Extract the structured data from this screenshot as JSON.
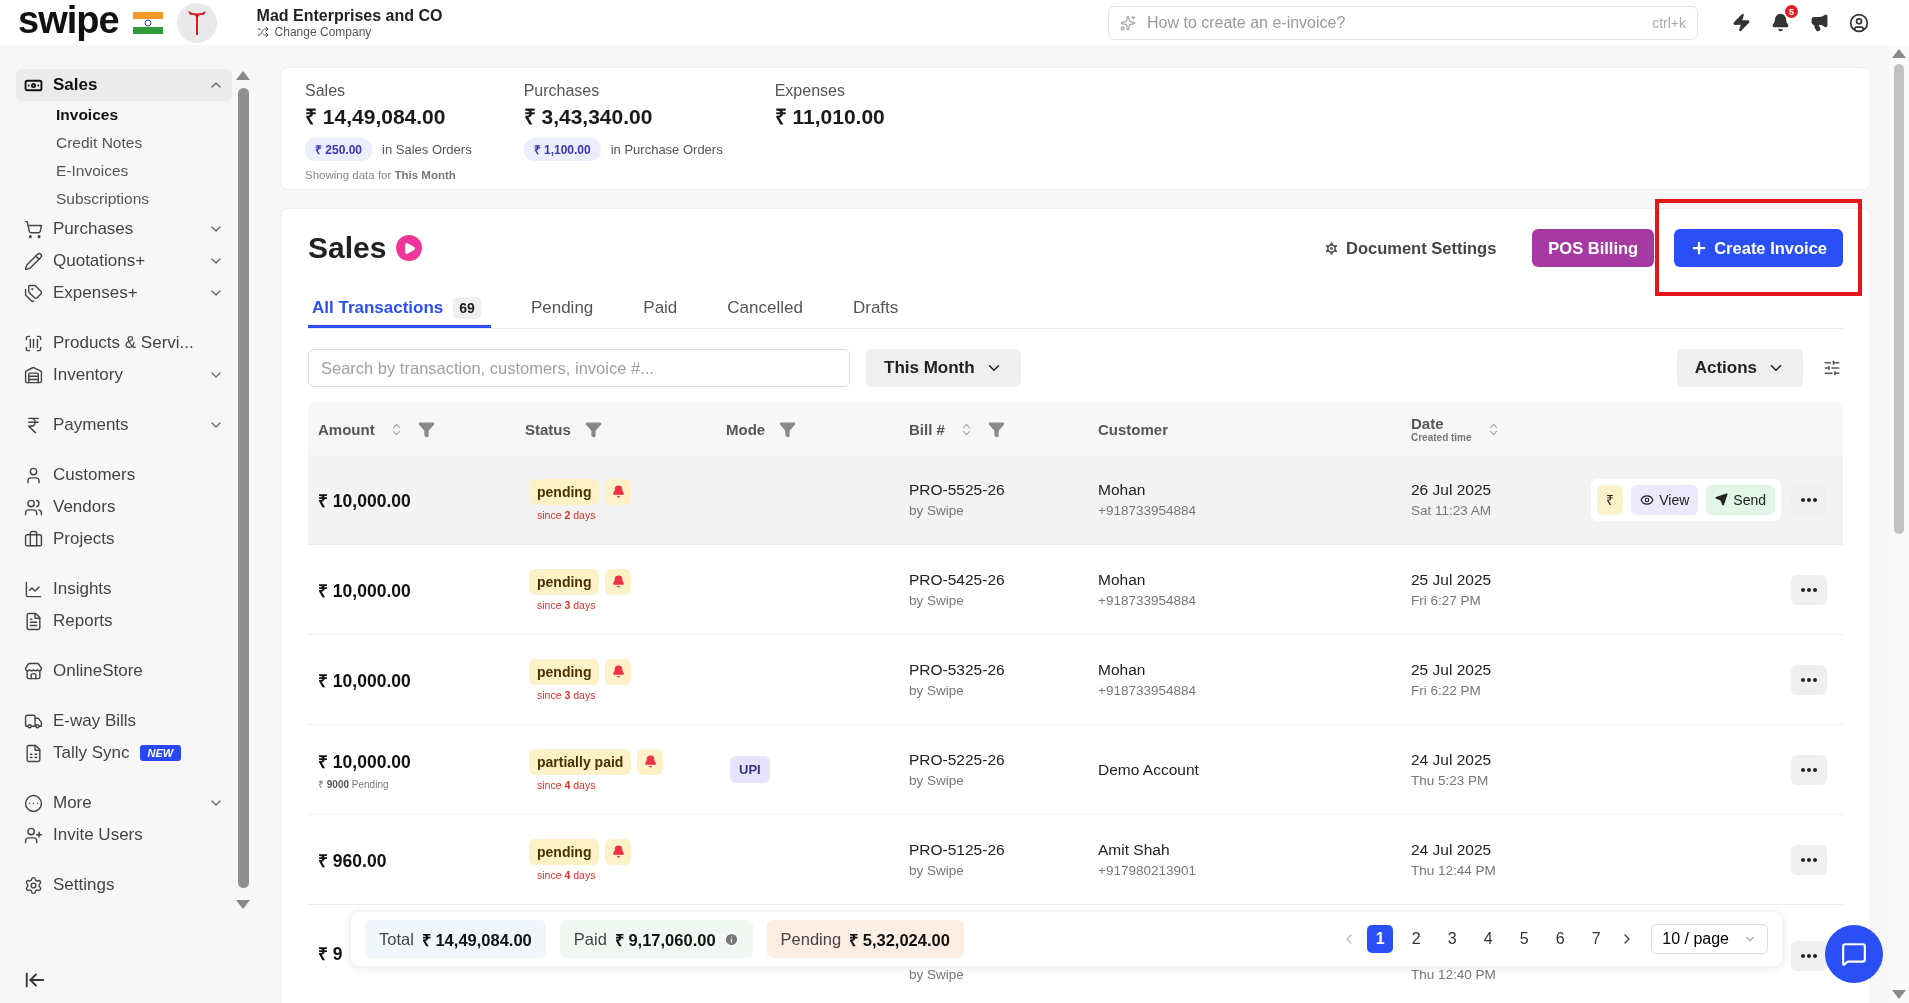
{
  "header": {
    "logo": "swipe",
    "company": "Mad Enterprises and CO",
    "change_company": "Change Company",
    "search": {
      "placeholder": "How to create an e-invoice?",
      "shortcut": "ctrl+k"
    },
    "notification_count": "5"
  },
  "sidebar": {
    "groups": [
      [
        {
          "label": "Sales",
          "expanded": true,
          "selected": true,
          "children": [
            {
              "label": "Invoices",
              "selected": true
            },
            {
              "label": "Credit Notes",
              "selected": false
            },
            {
              "label": "E-Invoices",
              "selected": false
            },
            {
              "label": "Subscriptions",
              "selected": false
            }
          ]
        },
        {
          "label": "Purchases",
          "expanded": false,
          "selected": false
        },
        {
          "label": "Quotations+",
          "expanded": false,
          "selected": false
        },
        {
          "label": "Expenses+",
          "expanded": false,
          "selected": false
        }
      ],
      [
        {
          "label": "Products & Servi...",
          "selected": false
        },
        {
          "label": "Inventory",
          "expanded": false,
          "selected": false
        }
      ],
      [
        {
          "label": "Payments",
          "expanded": false,
          "selected": false
        }
      ],
      [
        {
          "label": "Customers",
          "selected": false
        },
        {
          "label": "Vendors",
          "selected": false
        },
        {
          "label": "Projects",
          "selected": false
        }
      ],
      [
        {
          "label": "Insights",
          "selected": false
        },
        {
          "label": "Reports",
          "selected": false
        }
      ],
      [
        {
          "label": "OnlineStore",
          "selected": false
        }
      ],
      [
        {
          "label": "E-way Bills",
          "selected": false
        },
        {
          "label": "Tally Sync",
          "badge": "NEW",
          "selected": false
        }
      ],
      [
        {
          "label": "More",
          "expanded": false,
          "selected": false
        },
        {
          "label": "Invite Users",
          "selected": false
        }
      ],
      [
        {
          "label": "Settings",
          "selected": false
        }
      ]
    ]
  },
  "summary": {
    "stats": [
      {
        "label": "Sales",
        "value": "₹ 14,49,084.00",
        "chip": "₹ 250.00",
        "chip_label": "in Sales Orders"
      },
      {
        "label": "Purchases",
        "value": "₹ 3,43,340.00",
        "chip": "₹ 1,100.00",
        "chip_label": "in Purchase Orders"
      },
      {
        "label": "Expenses",
        "value": "₹ 11,010.00"
      }
    ],
    "note": "Showing data for **This Month**"
  },
  "page": {
    "title": "Sales",
    "buttons": [
      {
        "kind": "settings",
        "label": "Document Settings"
      },
      {
        "kind": "pos",
        "label": "POS Billing"
      },
      {
        "kind": "create",
        "label": "Create Invoice",
        "highlighted": true
      }
    ]
  },
  "tabs": [
    {
      "label": "All Transactions",
      "count": "69",
      "selected": true
    },
    {
      "label": "Pending",
      "selected": false
    },
    {
      "label": "Paid",
      "selected": false
    },
    {
      "label": "Cancelled",
      "selected": false
    },
    {
      "label": "Drafts",
      "selected": false
    }
  ],
  "filters": {
    "search_placeholder": "Search by transaction, customers, invoice #...",
    "period": "This Month",
    "actions": "Actions"
  },
  "table": {
    "columns": [
      {
        "label": "Amount",
        "controls": [
          {
            "kind": "sort"
          },
          {
            "kind": "filter"
          }
        ]
      },
      {
        "label": "Status",
        "controls": [
          {
            "kind": "filter"
          }
        ]
      },
      {
        "label": "Mode",
        "controls": [
          {
            "kind": "filter"
          }
        ]
      },
      {
        "label": "Bill #",
        "controls": [
          {
            "kind": "sort"
          },
          {
            "kind": "filter"
          }
        ]
      },
      {
        "label": "Customer"
      },
      {
        "label": "Date",
        "sub": "Created time",
        "controls": [
          {
            "kind": "sort"
          }
        ]
      }
    ],
    "rows": [
      {
        "highlighted": true,
        "amount": "₹ 10,000.00",
        "status": "pending",
        "since": "since **2** days",
        "bill": "PRO-5525-26",
        "bill_by": "by Swipe",
        "customer": "Mohan",
        "phone": "+918733954884",
        "date": "26 Jul 2025",
        "time": "Sat 11:23 AM",
        "actions": [
          {
            "kind": "pay",
            "label": "₹"
          },
          {
            "kind": "view",
            "label": "View"
          },
          {
            "kind": "send",
            "label": "Send"
          }
        ]
      },
      {
        "highlighted": false,
        "amount": "₹ 10,000.00",
        "status": "pending",
        "since": "since **3** days",
        "bill": "PRO-5425-26",
        "bill_by": "by Swipe",
        "customer": "Mohan",
        "phone": "+918733954884",
        "date": "25 Jul 2025",
        "time": "Fri 6:27 PM"
      },
      {
        "highlighted": false,
        "amount": "₹ 10,000.00",
        "status": "pending",
        "since": "since **3** days",
        "bill": "PRO-5325-26",
        "bill_by": "by Swipe",
        "customer": "Mohan",
        "phone": "+918733954884",
        "date": "25 Jul 2025",
        "time": "Fri 6:22 PM"
      },
      {
        "highlighted": false,
        "amount": "₹ 10,000.00",
        "amount_note": "₹ **9000** Pending",
        "status": "partially paid",
        "since": "since **4** days",
        "mode": "UPI",
        "bill": "PRO-5225-26",
        "bill_by": "by Swipe",
        "customer": "Demo Account",
        "date": "24 Jul 2025",
        "time": "Thu 5:23 PM"
      },
      {
        "highlighted": false,
        "amount": "₹ 960.00",
        "status": "pending",
        "since": "since **4** days",
        "bill": "PRO-5125-26",
        "bill_by": "by Swipe",
        "customer": "Amit Shah",
        "phone": "+917980213901",
        "date": "24 Jul 2025",
        "time": "Thu 12:44 PM"
      },
      {
        "amount": "₹ 9",
        "bill_by": "by Swipe",
        "time": "Thu 12:40 PM"
      }
    ]
  },
  "totals": [
    {
      "kind": "total",
      "label": "Total",
      "value": "₹ 14,49,084.00"
    },
    {
      "kind": "paid",
      "label": "Paid",
      "value": "₹ 9,17,060.00",
      "info": true
    },
    {
      "kind": "pending",
      "label": "Pending",
      "value": "₹ 5,32,024.00"
    }
  ],
  "pagination": {
    "pages": [
      {
        "label": "1",
        "selected": true
      },
      {
        "label": "2",
        "selected": false
      },
      {
        "label": "3",
        "selected": false
      },
      {
        "label": "4",
        "selected": false
      },
      {
        "label": "5",
        "selected": false
      },
      {
        "label": "6",
        "selected": false
      },
      {
        "label": "7",
        "selected": false
      }
    ],
    "page_size": "10 / page"
  }
}
